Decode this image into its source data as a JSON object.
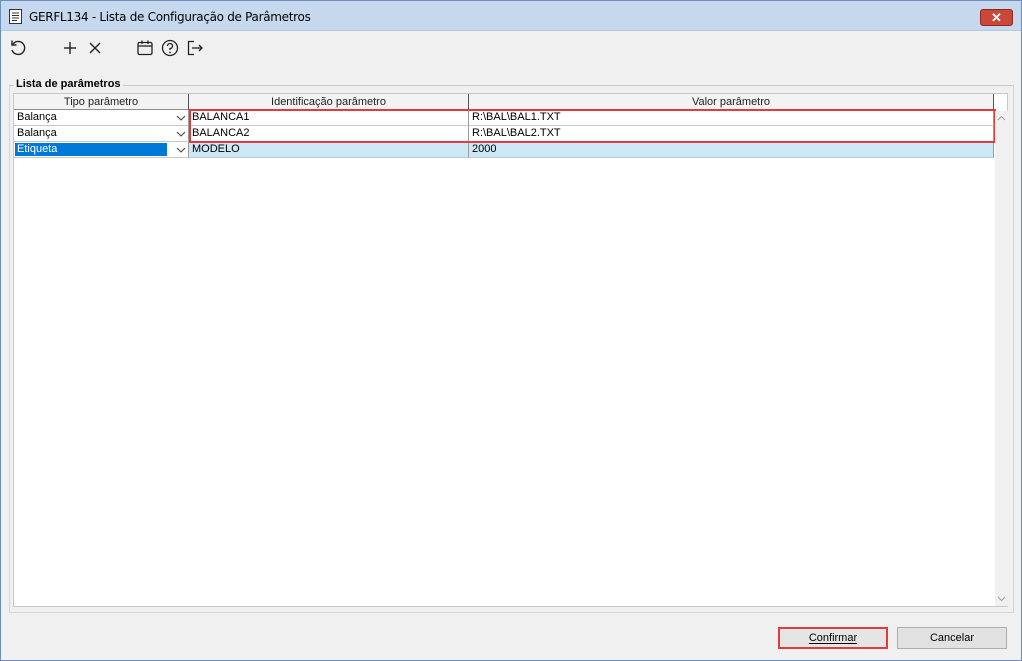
{
  "window": {
    "title": "GERFL134 - Lista de Configuração de Parâmetros",
    "close_label": "✕"
  },
  "toolbar": {
    "buttons": [
      {
        "name": "refresh",
        "icon": "refresh-icon"
      },
      {
        "name": "add",
        "icon": "plus-icon"
      },
      {
        "name": "delete",
        "icon": "close-x-icon"
      },
      {
        "name": "calendar",
        "icon": "calendar-icon"
      },
      {
        "name": "help",
        "icon": "help-circle-icon"
      },
      {
        "name": "exit",
        "icon": "exit-icon"
      }
    ]
  },
  "group": {
    "legend": "Lista de parâmetros"
  },
  "grid": {
    "headers": [
      "Tipo parâmetro",
      "Identificação parâmetro",
      "Valor parâmetro"
    ],
    "rows": [
      {
        "tipo": "Balança",
        "id": "BALANCA1",
        "valor": "R:\\BAL\\BAL1.TXT"
      },
      {
        "tipo": "Balança",
        "id": "BALANCA2",
        "valor": "R:\\BAL\\BAL2.TXT"
      },
      {
        "tipo": "Etiqueta",
        "id": "MODELO",
        "valor": "2000"
      }
    ]
  },
  "footer": {
    "confirm_label": "Confirmar",
    "cancel_label": "Cancelar"
  },
  "colors": {
    "highlight": "#e03c3c",
    "selection": "#0078d7",
    "selected_row": "#cce8f6"
  }
}
